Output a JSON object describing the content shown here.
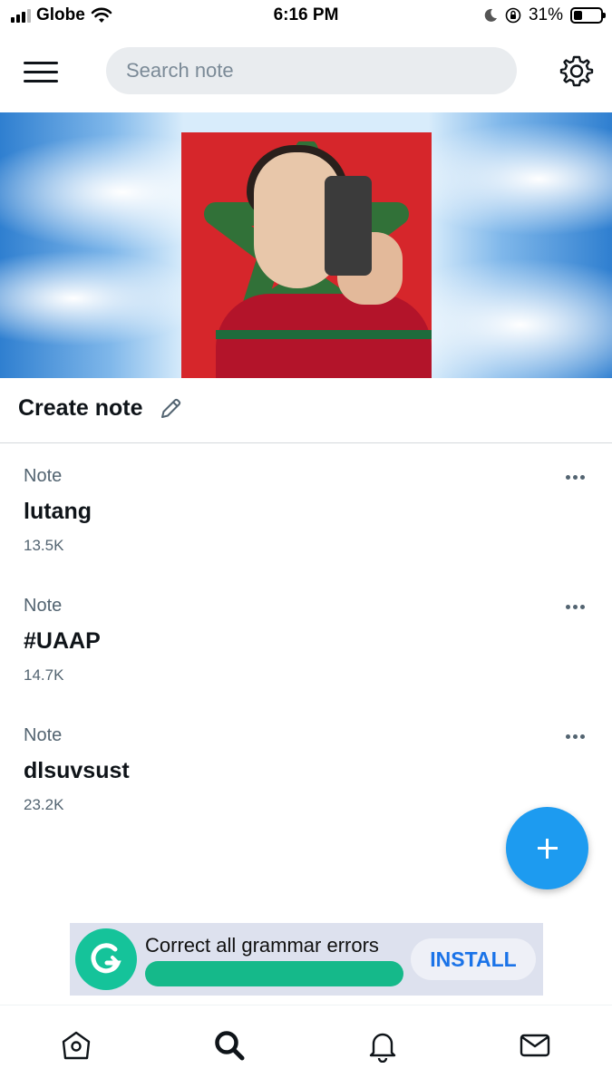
{
  "status_bar": {
    "carrier": "Globe",
    "time": "6:16 PM",
    "battery_percent": "31%",
    "battery_level": 0.31
  },
  "header": {
    "search_placeholder": "Search note",
    "menu_icon": "hamburger-menu-icon",
    "settings_icon": "gear-icon"
  },
  "banner": {
    "description_icon": "banner-image"
  },
  "create_note": {
    "title": "Create note",
    "icon": "pencil-icon"
  },
  "notes": [
    {
      "label": "Note",
      "name": "lutang",
      "count": "13.5K"
    },
    {
      "label": "Note",
      "name": "#UAAP",
      "count": "14.7K"
    },
    {
      "label": "Note",
      "name": "dlsuvsust",
      "count": "23.2K"
    }
  ],
  "fab": {
    "icon": "plus-icon",
    "color": "#1d9bf0"
  },
  "ad": {
    "text": "Correct all grammar errors",
    "button": "INSTALL",
    "logo_icon": "grammarly-logo-icon",
    "accent": "#15c39a"
  },
  "bottom_nav": [
    {
      "icon": "home-icon"
    },
    {
      "icon": "search-icon"
    },
    {
      "icon": "bell-icon"
    },
    {
      "icon": "mail-icon"
    }
  ]
}
